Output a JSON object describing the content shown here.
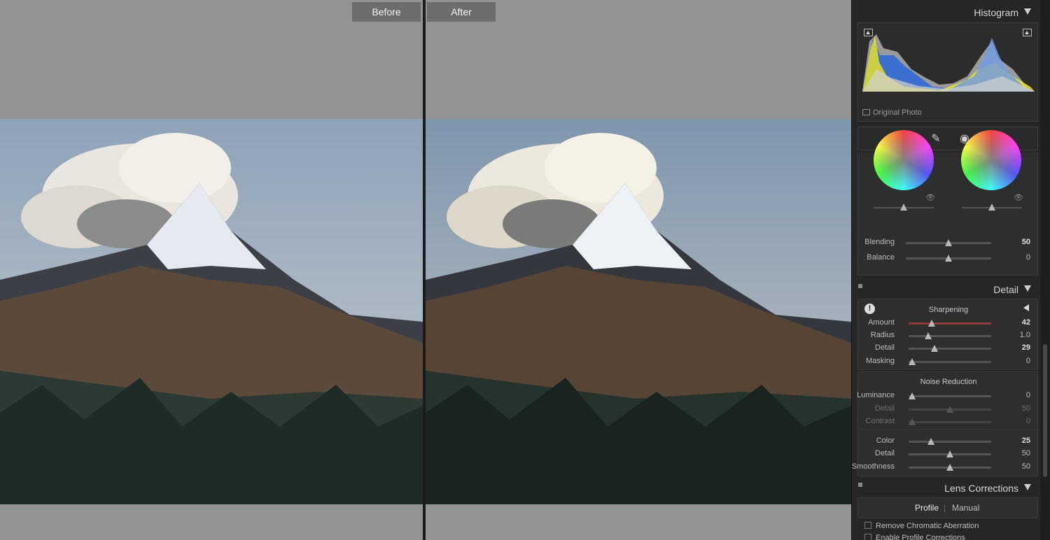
{
  "compare": {
    "before_label": "Before",
    "after_label": "After"
  },
  "histogram": {
    "title": "Histogram",
    "original_photo_label": "Original Photo"
  },
  "tools": [
    "crop-icon",
    "heal-icon",
    "red-eye-icon",
    "mask-icon"
  ],
  "color_grading": {
    "blending_label": "Blending",
    "blending_value": "50",
    "balance_label": "Balance",
    "balance_value": "0"
  },
  "detail": {
    "title": "Detail",
    "sharpening": {
      "title": "Sharpening",
      "amount_label": "Amount",
      "amount_value": "42",
      "radius_label": "Radius",
      "radius_value": "1.0",
      "detail_label": "Detail",
      "detail_value": "29",
      "masking_label": "Masking",
      "masking_value": "0"
    },
    "noise_reduction": {
      "title": "Noise Reduction",
      "luminance_label": "Luminance",
      "luminance_value": "0",
      "lum_detail_label": "Detail",
      "lum_detail_value": "50",
      "contrast_label": "Contrast",
      "contrast_value": "0",
      "color_label": "Color",
      "color_value": "25",
      "color_detail_label": "Detail",
      "color_detail_value": "50",
      "smoothness_label": "Smoothness",
      "smoothness_value": "50"
    }
  },
  "lens_corrections": {
    "title": "Lens Corrections",
    "tab_profile": "Profile",
    "tab_separator": "|",
    "tab_manual": "Manual",
    "remove_ca_label": "Remove Chromatic Aberration",
    "enable_profile_label": "Enable Profile Corrections"
  },
  "sliders": {
    "blending": 0.5,
    "balance": 0.5,
    "amount": 0.28,
    "radius": 0.24,
    "detail": 0.31,
    "masking": 0.04,
    "luminance": 0.04,
    "lum_detail": 0.5,
    "contrast": 0.04,
    "color": 0.27,
    "color_detail": 0.5,
    "smoothness": 0.5
  },
  "colors": {
    "accent_red": "#8e3a3a",
    "panel_bg": "#262626"
  }
}
